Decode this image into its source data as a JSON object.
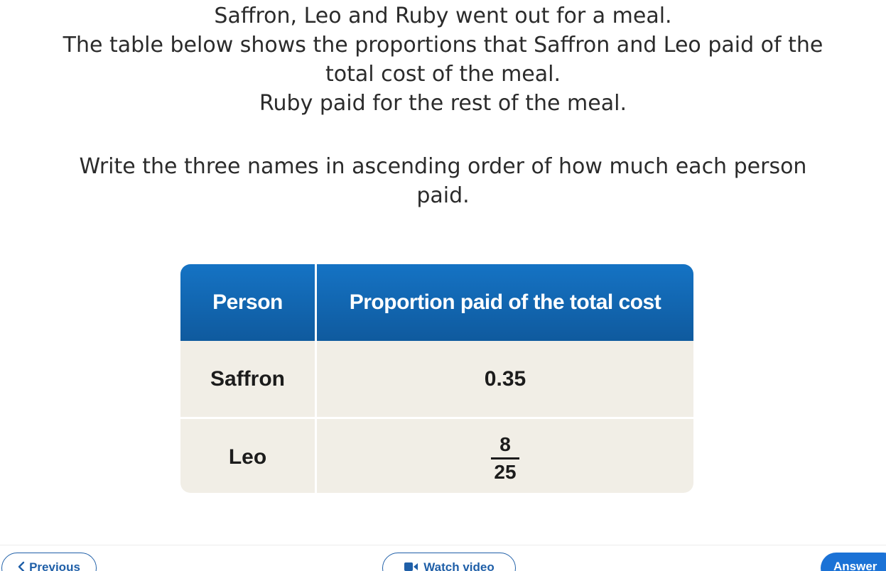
{
  "question": {
    "lines": [
      "Saffron, Leo and Ruby went out for a meal.",
      "The table below shows the proportions that Saffron and Leo paid of the",
      "total cost of the meal.",
      "Ruby paid for the rest of the meal."
    ],
    "instruction": [
      "Write the three names in ascending order of how much each person",
      "paid."
    ]
  },
  "table": {
    "headers": [
      "Person",
      "Proportion paid of the total cost"
    ],
    "rows": [
      {
        "person": "Saffron",
        "value": "0.35"
      },
      {
        "person": "Leo",
        "numerator": "8",
        "denominator": "25"
      }
    ],
    "header_color": "#1268b5",
    "row_color": "#f1eee6"
  },
  "nav": {
    "previous_label": "Previous",
    "previous_icon": "chevron-left-icon",
    "video_label": "Watch video",
    "video_icon": "video-camera-icon",
    "answer_label": "Answer",
    "accent_color": "#1b72d6"
  }
}
